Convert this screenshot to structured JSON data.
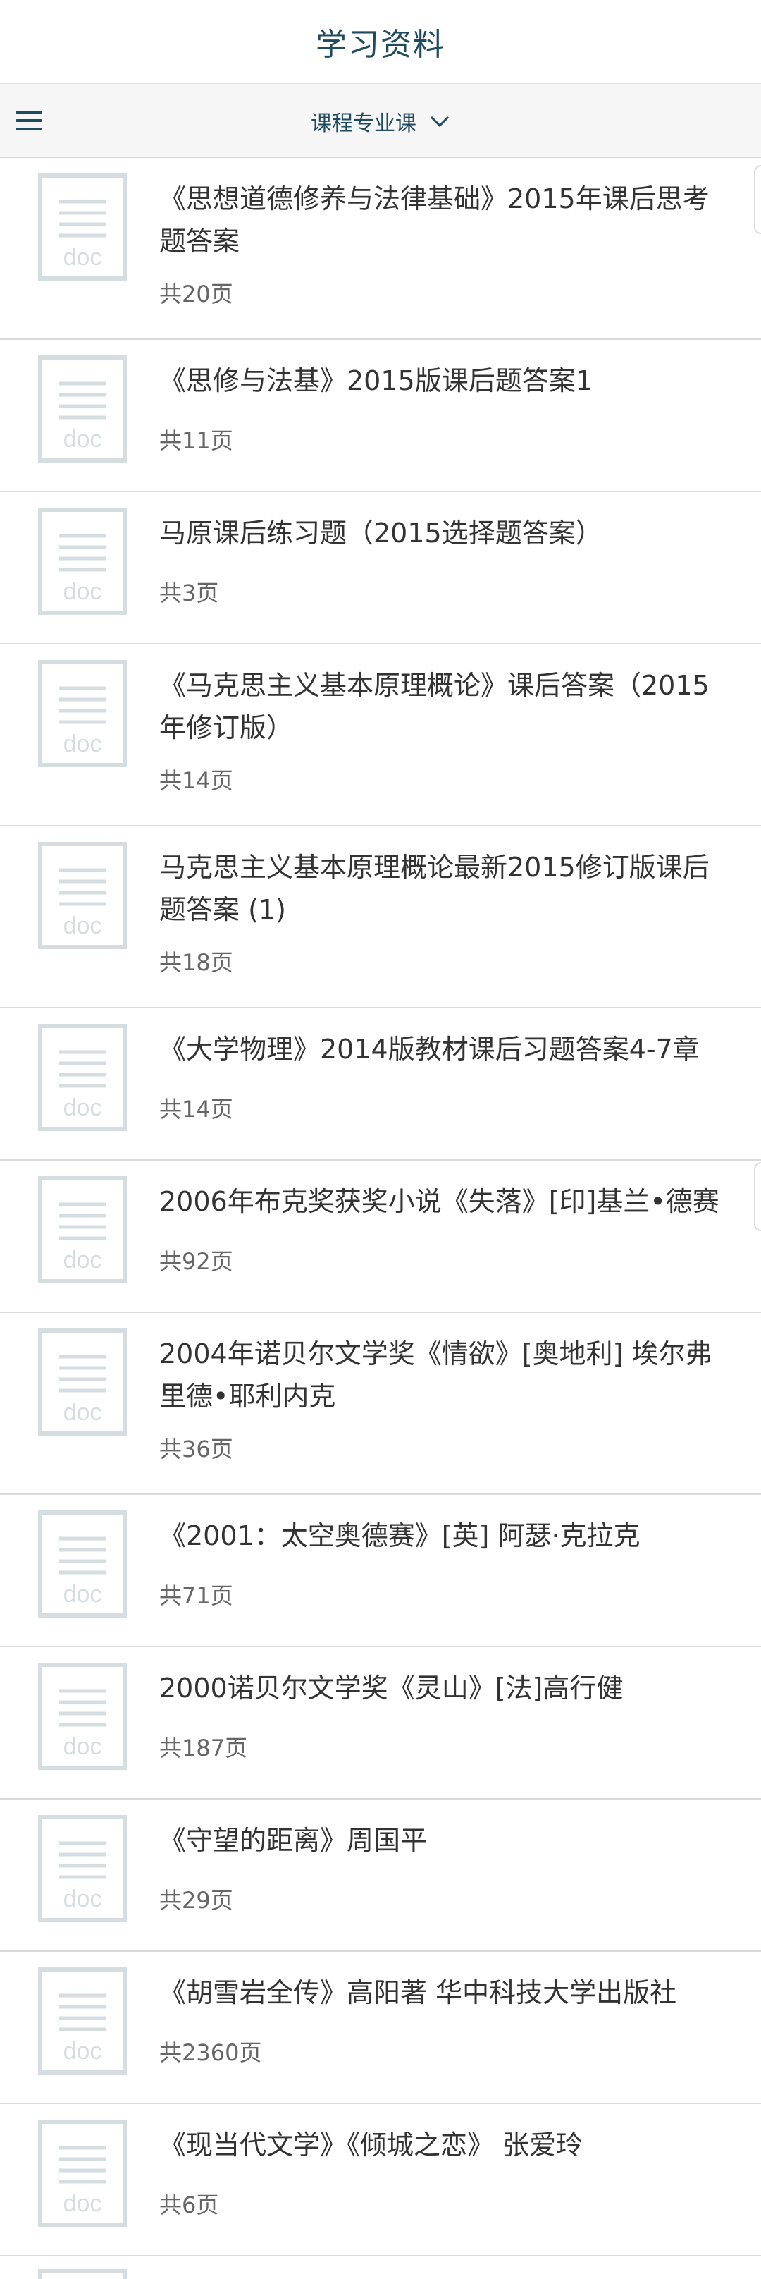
{
  "header": {
    "title": "学习资料"
  },
  "filter": {
    "category_label": "课程专业课"
  },
  "icons": {
    "menu": "menu-icon",
    "dropdown": "chevron-down-icon",
    "document": "doc-file-icon"
  },
  "colors": {
    "accent": "#1e4b5e",
    "doc_icon": "#d5dde0",
    "divider": "#dadada"
  },
  "documents": [
    {
      "title": "《思想道德修养与法律基础》2015年课后思考题答案",
      "pages": "共20页"
    },
    {
      "title": "《思修与法基》2015版课后题答案1",
      "pages": "共11页"
    },
    {
      "title": "马原课后练习题（2015选择题答案）",
      "pages": "共3页"
    },
    {
      "title": "《马克思主义基本原理概论》课后答案（2015年修订版）",
      "pages": "共14页"
    },
    {
      "title": "马克思主义基本原理概论最新2015修订版课后题答案 (1)",
      "pages": "共18页"
    },
    {
      "title": "《大学物理》2014版教材课后习题答案4-7章",
      "pages": "共14页"
    },
    {
      "title": "2006年布克奖获奖小说《失落》[印]基兰•德赛",
      "pages": "共92页"
    },
    {
      "title": "2004年诺贝尔文学奖《情欲》[奥地利] 埃尔弗里德•耶利内克",
      "pages": "共36页"
    },
    {
      "title": "《2001：太空奥德赛》[英] 阿瑟·克拉克",
      "pages": "共71页"
    },
    {
      "title": "2000诺贝尔文学奖《灵山》[法]高行健",
      "pages": "共187页"
    },
    {
      "title": "《守望的距离》周国平",
      "pages": "共29页"
    },
    {
      "title": "《胡雪岩全传》高阳著 华中科技大学出版社",
      "pages": "共2360页"
    },
    {
      "title": "《现当代文学》《倾城之恋》 张爱玲",
      "pages": "共6页"
    }
  ]
}
